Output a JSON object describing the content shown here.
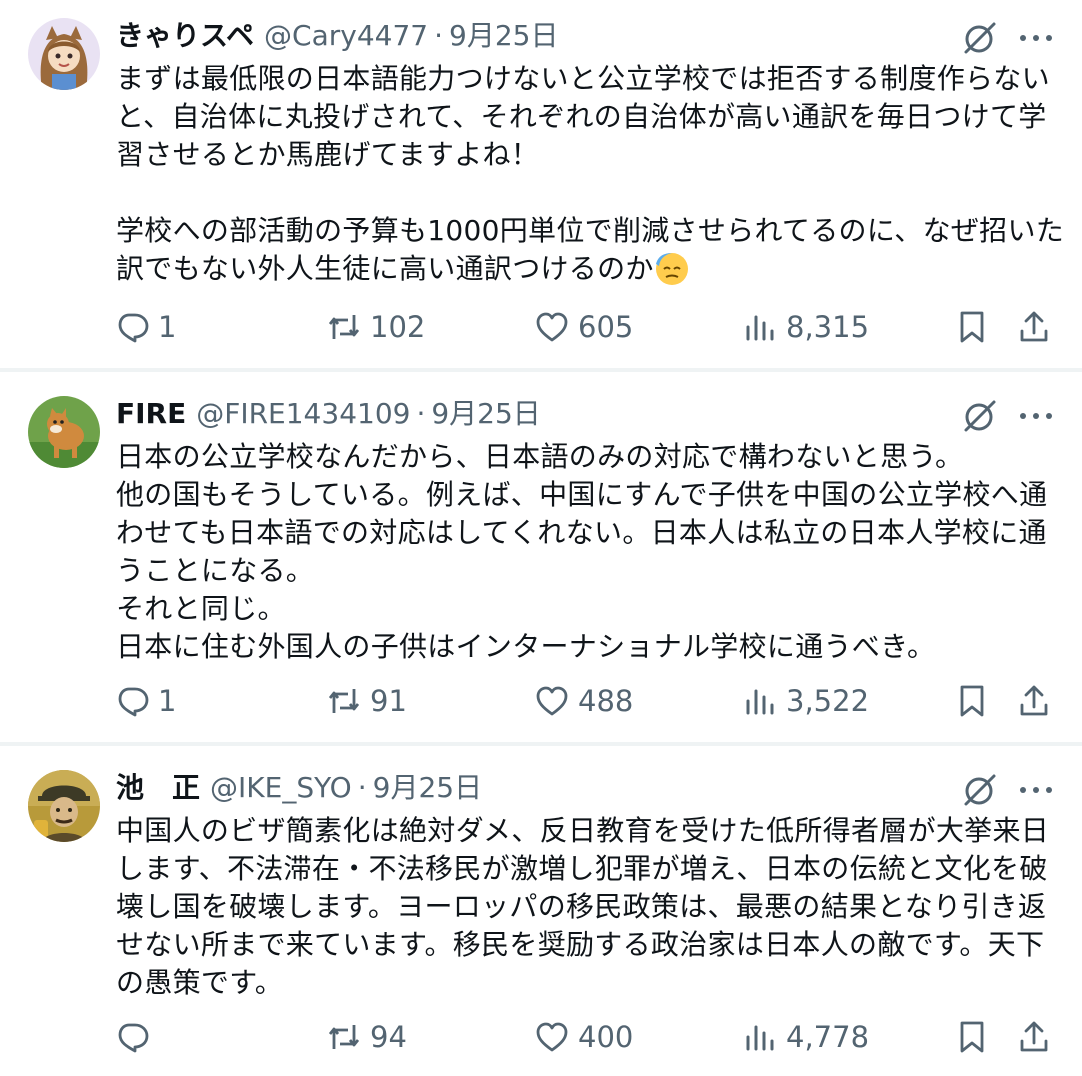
{
  "tweets": [
    {
      "name": "きゃりスペ",
      "handle": "@Cary4477",
      "separator": "·",
      "date": "9月25日",
      "text_before_emoji": "まずは最低限の日本語能力つけないと公立学校では拒否する制度作らないと、自治体に丸投げされて、それぞれの自治体が高い通訳を毎日つけて学習させるとか馬鹿げてますよね！\n\n学校への部活動の予算も1000円単位で削減させられてるのに、なぜ招いた訳でもない外人生徒に高い通訳つけるのか",
      "emoji": "downcast-face-with-sweat",
      "counts": {
        "replies": "1",
        "reposts": "102",
        "likes": "605",
        "views": "8,315"
      }
    },
    {
      "name": "FIRE",
      "handle": "@FIRE1434109",
      "separator": "·",
      "date": "9月25日",
      "text": "日本の公立学校なんだから、日本語のみの対応で構わないと思う。\n他の国もそうしている。例えば、中国にすんで子供を中国の公立学校へ通わせても日本語での対応はしてくれない。日本人は私立の日本人学校に通うことになる。\nそれと同じ。\n日本に住む外国人の子供はインターナショナル学校に通うべき。",
      "counts": {
        "replies": "1",
        "reposts": "91",
        "likes": "488",
        "views": "3,522"
      }
    },
    {
      "name": "池　正",
      "handle": "@IKE_SYO",
      "separator": "·",
      "date": "9月25日",
      "text": "中国人のビザ簡素化は絶対ダメ、反日教育を受けた低所得者層が大挙来日します、不法滞在・不法移民が激増し犯罪が増え、日本の伝統と文化を破壊し国を破壊します。ヨーロッパの移民政策は、最悪の結果となり引き返せない所まで来ています。移民を奨励する政治家は日本人の敵です。天下の愚策です。",
      "counts": {
        "replies": "",
        "reposts": "94",
        "likes": "400",
        "views": "4,778"
      }
    }
  ],
  "icons": {
    "reply": "reply-icon",
    "repost": "repost-icon",
    "like": "heart-icon",
    "views": "views-icon",
    "bookmark": "bookmark-icon",
    "share": "share-icon",
    "grok": "grok-icon",
    "more": "more-icon"
  },
  "colors": {
    "text": "#0f1419",
    "muted": "#536471",
    "divider": "#eff3f4"
  }
}
